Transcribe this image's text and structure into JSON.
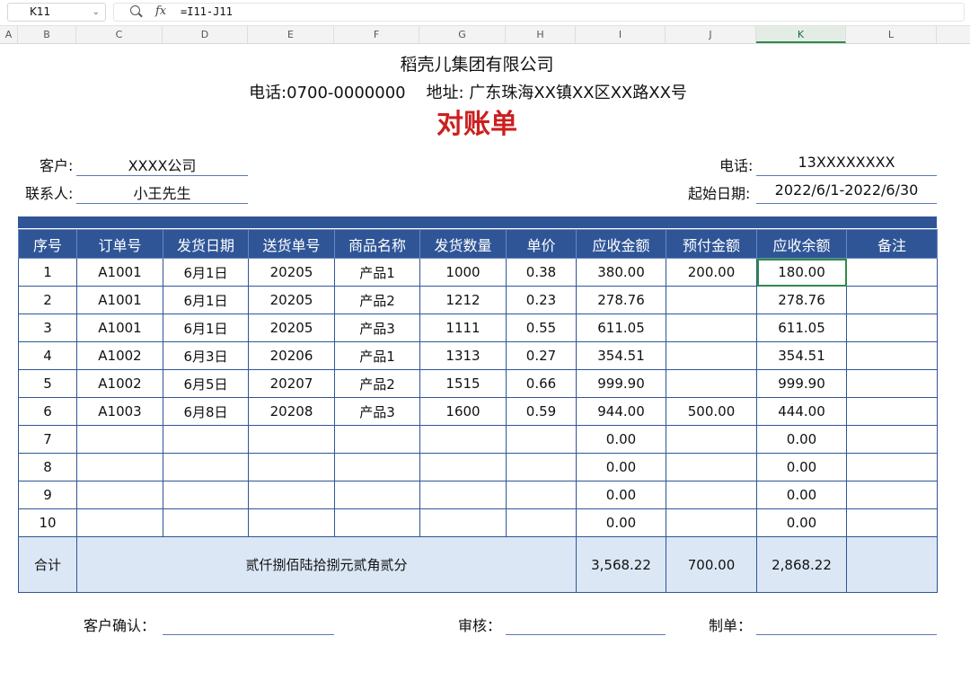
{
  "formula_bar": {
    "cell_ref": "K11",
    "formula": "=I11-J11"
  },
  "columns": [
    "A",
    "B",
    "C",
    "D",
    "E",
    "F",
    "G",
    "H",
    "I",
    "J",
    "K",
    "L"
  ],
  "active_column": "K",
  "sheet": {
    "company": "稻壳儿集团有限公司",
    "contact_line": "电话:0700-0000000    地址: 广东珠海XX镇XX区XX路XX号",
    "title": "对账单",
    "customer_label": "客户:",
    "customer_value": "XXXX公司",
    "contact_label": "联系人:",
    "contact_value": "小王先生",
    "phone_label": "电话:",
    "phone_value": "13XXXXXXXX",
    "period_label": "起始日期:",
    "period_value": "2022/6/1-2022/6/30",
    "table": {
      "headers": [
        "序号",
        "订单号",
        "发货日期",
        "送货单号",
        "商品名称",
        "发货数量",
        "单价",
        "应收金额",
        "预付金额",
        "应收余额",
        "备注"
      ],
      "rows": [
        [
          "1",
          "A1001",
          "6月1日",
          "20205",
          "产品1",
          "1000",
          "0.38",
          "380.00",
          "200.00",
          "180.00",
          ""
        ],
        [
          "2",
          "A1001",
          "6月1日",
          "20205",
          "产品2",
          "1212",
          "0.23",
          "278.76",
          "",
          "278.76",
          ""
        ],
        [
          "3",
          "A1001",
          "6月1日",
          "20205",
          "产品3",
          "1111",
          "0.55",
          "611.05",
          "",
          "611.05",
          ""
        ],
        [
          "4",
          "A1002",
          "6月3日",
          "20206",
          "产品1",
          "1313",
          "0.27",
          "354.51",
          "",
          "354.51",
          ""
        ],
        [
          "5",
          "A1002",
          "6月5日",
          "20207",
          "产品2",
          "1515",
          "0.66",
          "999.90",
          "",
          "999.90",
          ""
        ],
        [
          "6",
          "A1003",
          "6月8日",
          "20208",
          "产品3",
          "1600",
          "0.59",
          "944.00",
          "500.00",
          "444.00",
          ""
        ],
        [
          "7",
          "",
          "",
          "",
          "",
          "",
          "",
          "0.00",
          "",
          "0.00",
          ""
        ],
        [
          "8",
          "",
          "",
          "",
          "",
          "",
          "",
          "0.00",
          "",
          "0.00",
          ""
        ],
        [
          "9",
          "",
          "",
          "",
          "",
          "",
          "",
          "0.00",
          "",
          "0.00",
          ""
        ],
        [
          "10",
          "",
          "",
          "",
          "",
          "",
          "",
          "0.00",
          "",
          "0.00",
          ""
        ]
      ],
      "total": {
        "label": "合计",
        "amount_in_words": "贰仟捌佰陆拾捌元贰角贰分",
        "receivable": "3,568.22",
        "prepaid": "700.00",
        "balance": "2,868.22",
        "remark": ""
      }
    },
    "confirm_label": "客户确认：",
    "review_label": "审核：",
    "maker_label": "制单："
  }
}
